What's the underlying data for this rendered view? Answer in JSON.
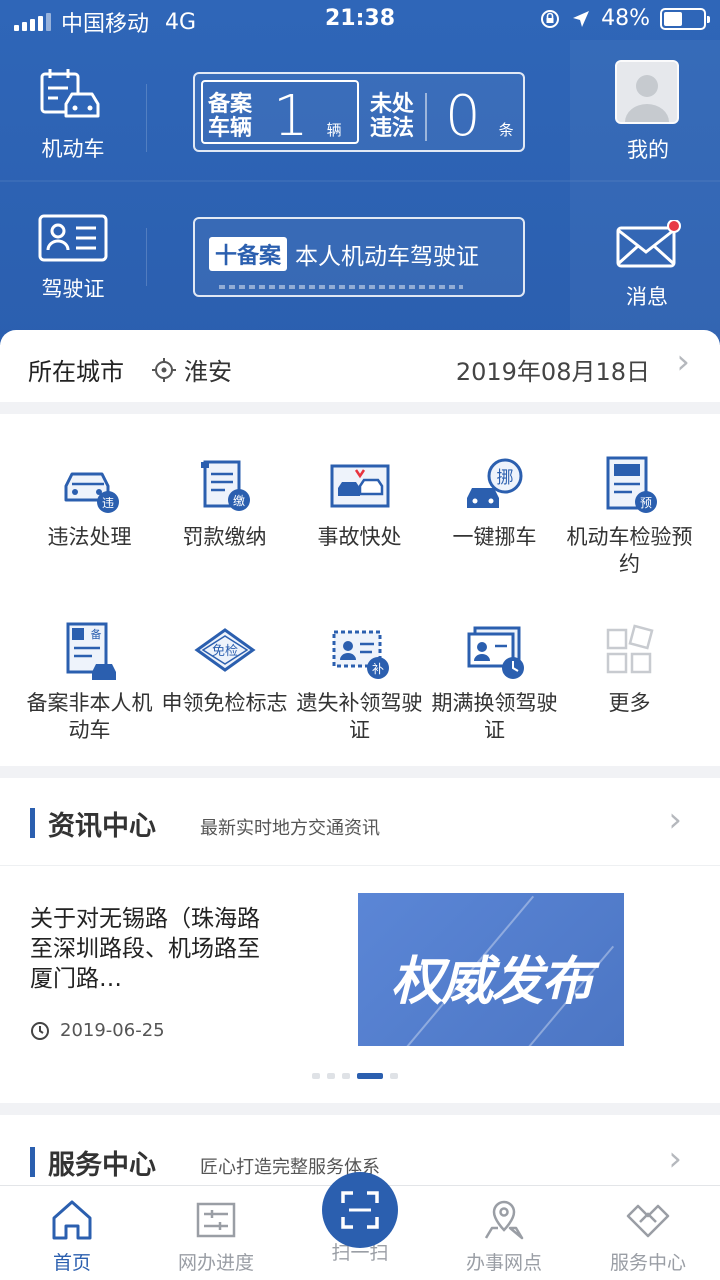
{
  "status_bar": {
    "carrier": "中国移动",
    "network": "4G",
    "time": "21:38",
    "battery": "48%",
    "battery_level": 0.48
  },
  "header": {
    "vehicle_label": "机动车",
    "license_label": "驾驶证",
    "mine_label": "我的",
    "message_label": "消息",
    "registered_tag": "备案车辆",
    "registered_count": "1",
    "registered_unit": "辆",
    "violation_tag": "未处违法",
    "violation_count": "0",
    "violation_unit": "条",
    "add_badge": "十备案",
    "add_text": "本人机动车驾驶证"
  },
  "city": {
    "label": "所在城市",
    "name": "淮安",
    "date": "2019年08月18日"
  },
  "services": [
    {
      "label": "违法处理",
      "badge": "违"
    },
    {
      "label": "罚款缴纳",
      "badge": "缴"
    },
    {
      "label": "事故快处",
      "badge": ""
    },
    {
      "label": "一键挪车",
      "badge": "挪"
    },
    {
      "label": "机动车检验预约",
      "badge": "预"
    },
    {
      "label": "备案非本人机动车",
      "badge": "备"
    },
    {
      "label": "申领免检标志",
      "badge": "免检"
    },
    {
      "label": "遗失补领驾驶证",
      "badge": "补"
    },
    {
      "label": "期满换领驾驶证",
      "badge": ""
    },
    {
      "label": "更多",
      "badge": ""
    }
  ],
  "news": {
    "title": "资讯中心",
    "subtitle": "最新实时地方交通资讯",
    "item_title": "关于对无锡路（珠海路至深圳路段、机场路至厦门路…",
    "item_date": "2019-06-25",
    "image_text": "权威发布",
    "carousel_index": 3,
    "carousel_count": 5
  },
  "service_center": {
    "title": "服务中心",
    "subtitle": "匠心打造完整服务体系"
  },
  "tabs": [
    {
      "label": "首页",
      "active": true
    },
    {
      "label": "网办进度",
      "active": false
    },
    {
      "label": "扫一扫",
      "active": false
    },
    {
      "label": "办事网点",
      "active": false
    },
    {
      "label": "服务中心",
      "active": false
    }
  ],
  "colors": {
    "primary": "#2b5faf",
    "header_bg": "#2f66b8",
    "badge_red": "#e8343f"
  }
}
